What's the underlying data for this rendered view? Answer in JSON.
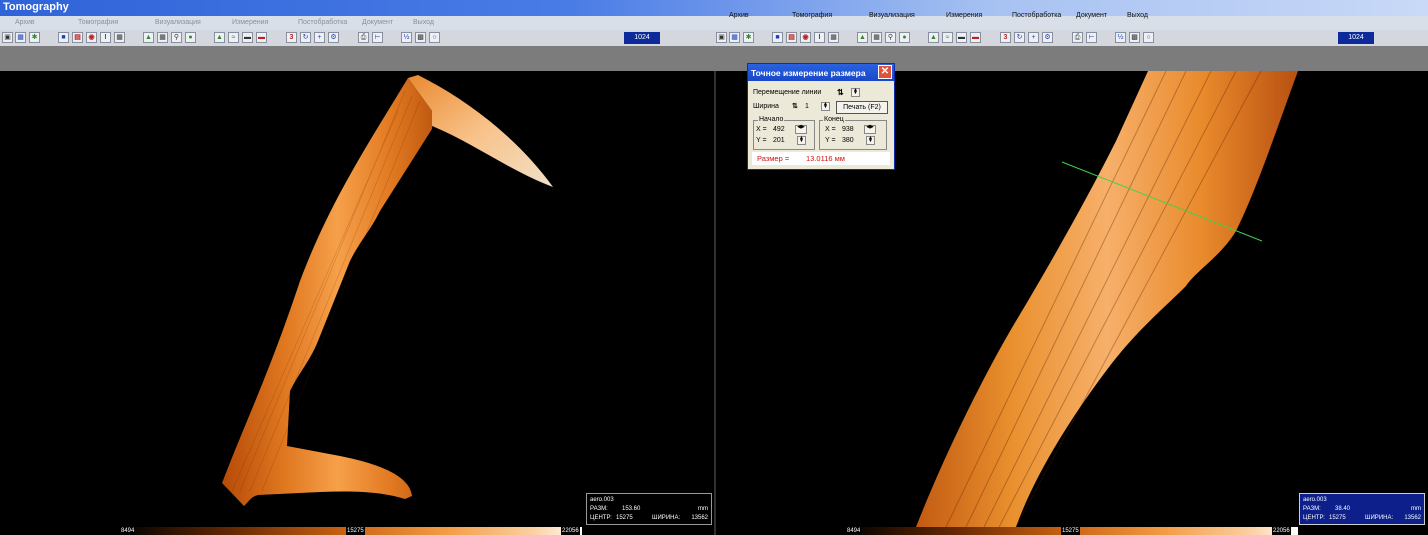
{
  "app": {
    "title": "Tomography"
  },
  "menu_left": [
    "Архив",
    "Томография",
    "Визуализация",
    "Измерения",
    "Постобработка",
    "Документ",
    "Выход"
  ],
  "menu_right": [
    "Архив",
    "Томография",
    "Визуализация",
    "Измерения",
    "Постобработка",
    "Документ",
    "Выход"
  ],
  "toolbar": {
    "resolution_left": "1024",
    "resolution_right": "1024"
  },
  "info_left": {
    "name": "aero.003",
    "size_label": "РАЗМ:",
    "size_value": "153.60",
    "unit": "mm",
    "center_label": "ЦЕНТР:",
    "center_value": "15275",
    "width_label": "ШИРИНА:",
    "width_value": "13562"
  },
  "info_right": {
    "name": "aero.003",
    "size_label": "РАЗМ:",
    "size_value": "38.40",
    "unit": "mm",
    "center_label": "ЦЕНТР:",
    "center_value": "15275",
    "width_label": "ШИРИНА:",
    "width_value": "13562"
  },
  "colorbar_left": {
    "min": "8494",
    "mid": "15275",
    "max": "22056"
  },
  "colorbar_right": {
    "min": "8494",
    "mid": "15275",
    "max": "22056"
  },
  "dialog": {
    "title": "Точное измерение размера",
    "move_line_label": "Перемещение линии",
    "width_label": "Ширина",
    "width_value": "1",
    "print_button": "Печать (F2)",
    "start_group": "Начало",
    "end_group": "Конец",
    "start_x_label": "X =",
    "start_x": "492",
    "start_y_label": "Y =",
    "start_y": "201",
    "end_x_label": "X =",
    "end_x": "938",
    "end_y_label": "Y =",
    "end_y": "380",
    "result_label": "Размер =",
    "result_value": "13.0116 мм"
  },
  "colors": {
    "title_bar": "#2f63d8",
    "resolution_badge": "#0c2a9a",
    "result_text": "#d01010",
    "measure_line": "#3fd24a"
  }
}
